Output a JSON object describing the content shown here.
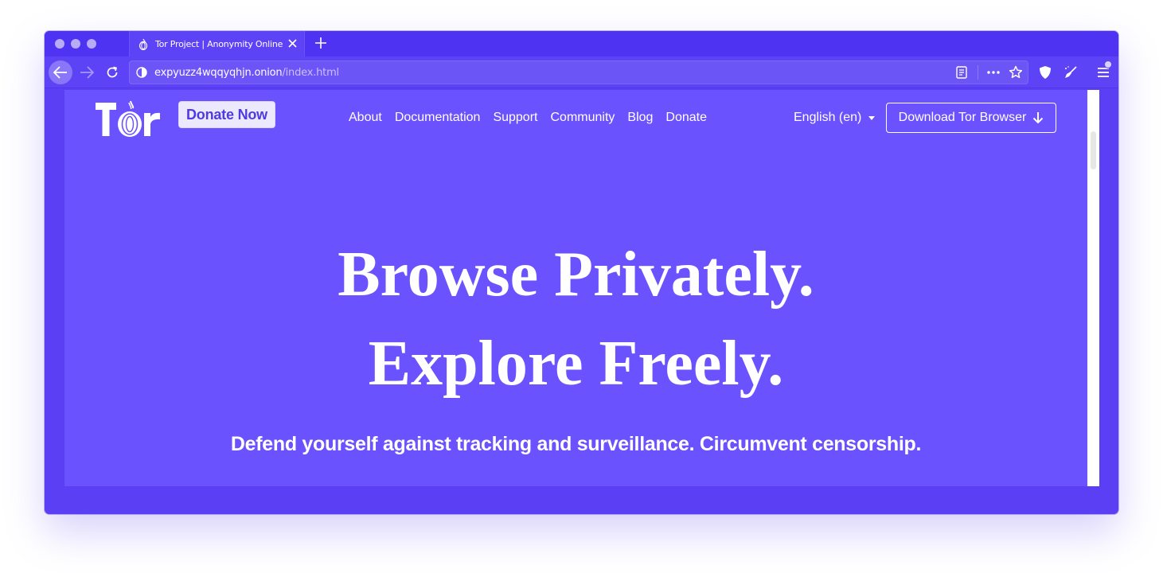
{
  "browser": {
    "tab": {
      "title": "Tor Project | Anonymity Online",
      "icon": "tor-onion-icon"
    },
    "url": {
      "host": "expyuzz4wqqyqhjn.onion",
      "path": "/index.html"
    },
    "accent_color": "#5b3ff5"
  },
  "site": {
    "logo_text": "Tor",
    "donate_button": "Donate Now",
    "nav": [
      {
        "label": "About"
      },
      {
        "label": "Documentation"
      },
      {
        "label": "Support"
      },
      {
        "label": "Community"
      },
      {
        "label": "Blog"
      },
      {
        "label": "Donate"
      }
    ],
    "language": "English (en)",
    "download_button": "Download Tor Browser",
    "hero_line_1": "Browse Privately.",
    "hero_line_2": "Explore Freely.",
    "subheading": "Defend yourself against tracking and surveillance. Circumvent censorship.",
    "background_color": "#6a52fe"
  }
}
